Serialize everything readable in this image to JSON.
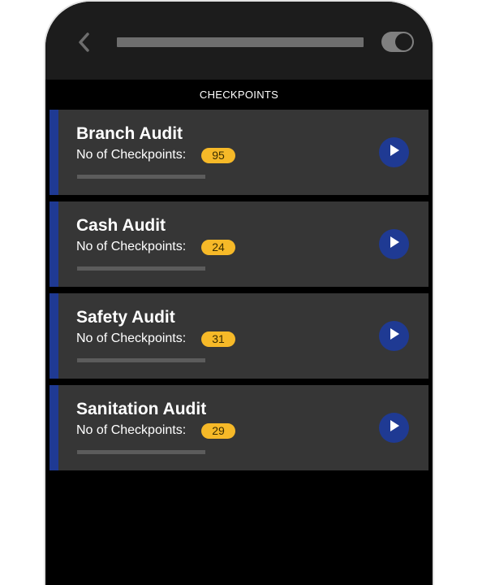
{
  "header": {
    "back_icon": "chevron-left-icon",
    "toggle_state": "on"
  },
  "section": {
    "title": "CHECKPOINTS"
  },
  "colors": {
    "accent": "#1f3a93",
    "badge": "#f6b928",
    "card": "#363636",
    "background": "#000000"
  },
  "audits": [
    {
      "title": "Branch Audit",
      "label": "No of Checkpoints:",
      "count": "95",
      "progress": 0
    },
    {
      "title": "Cash Audit",
      "label": "No of Checkpoints:",
      "count": "24",
      "progress": 0
    },
    {
      "title": "Safety Audit",
      "label": "No of Checkpoints:",
      "count": "31",
      "progress": 0
    },
    {
      "title": "Sanitation Audit",
      "label": "No of Checkpoints:",
      "count": "29",
      "progress": 0
    }
  ]
}
